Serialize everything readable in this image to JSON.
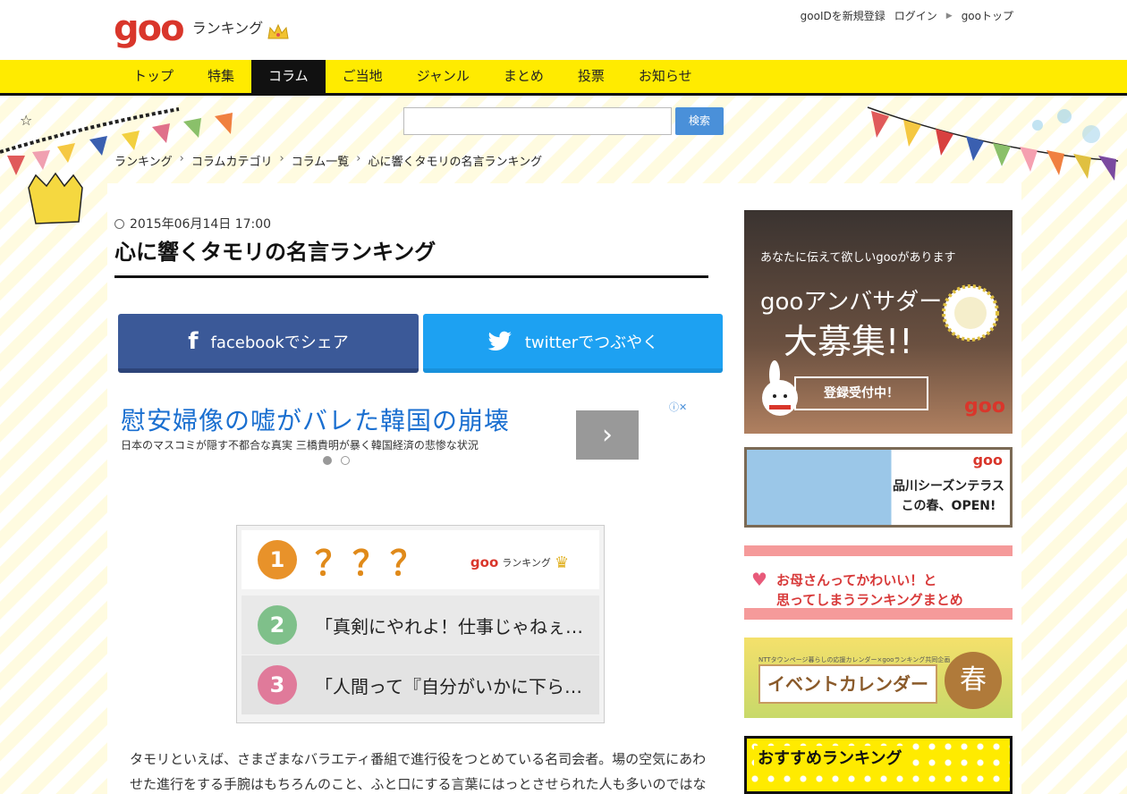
{
  "header": {
    "logo_goo": "goo",
    "logo_sub": "ランキング",
    "links": [
      "gooIDを新規登録",
      "ログイン",
      "gooトップ"
    ]
  },
  "nav": {
    "items": [
      "トップ",
      "特集",
      "コラム",
      "ご当地",
      "ジャンル",
      "まとめ",
      "投票",
      "お知らせ"
    ],
    "active": "コラム"
  },
  "search": {
    "button_label": "検索",
    "value": ""
  },
  "breadcrumb": [
    "ランキング",
    "コラムカテゴリ",
    "コラム一覧",
    "心に響くタモリの名言ランキング"
  ],
  "article": {
    "date": "2015年06月14日 17:00",
    "title": "心に響くタモリの名言ランキング",
    "share_facebook": "facebookでシェア",
    "share_twitter": "twitterでつぶやく",
    "body": "タモリといえば、さまざまなバラエティ番組で進行役をつとめている名司会者。場の空気にあわせた進行をする手腕はもちろんのこと、ふと口にする言葉にはっとさせられた人も多いのではな"
  },
  "ad": {
    "title": "慰安婦像の嘘がバレた韓国の崩壊",
    "subtitle": "日本のマスコミが隠す不都合な真実 三橋貴明が暴く韓国経済の悲惨な状況",
    "arrow": "›",
    "info": "ⓘ✕"
  },
  "ranking_card": {
    "logo_goo": "goo",
    "logo_sub": "ランキング",
    "rows": [
      {
        "num": "1",
        "text": "？？？",
        "color": "#e8922a"
      },
      {
        "num": "2",
        "text": "「真剣にやれよ！仕事じゃねぇ…",
        "color": "#7fc08a"
      },
      {
        "num": "3",
        "text": "「人間って『自分がいかに下ら…",
        "color": "#e07a9a"
      }
    ]
  },
  "sidebar": {
    "ambassador": {
      "line1": "あなたに伝えて欲しいgooがあります",
      "line2": "gooアンバサダー",
      "line3": "大募集!!",
      "button": "登録受付中！",
      "goo": "goo"
    },
    "shinagawa": {
      "goo": "goo",
      "line1": "品川シーズンテラス",
      "line2": "この春、OPEN!"
    },
    "haha": {
      "line1": "お母さんってかわいい！と",
      "line2": "思ってしまうランキングまとめ"
    },
    "event": {
      "small": "NTTタウンページ暮らしの応援カレンダー×gooランキング共同企画",
      "title": "イベントカレンダー",
      "circle": "春"
    },
    "osusume": {
      "title": "おすすめランキング"
    }
  },
  "colors": {
    "nav_bg": "#ffeb00",
    "goo_red": "#d9362b",
    "facebook": "#3b5998",
    "twitter": "#1da1f2"
  }
}
